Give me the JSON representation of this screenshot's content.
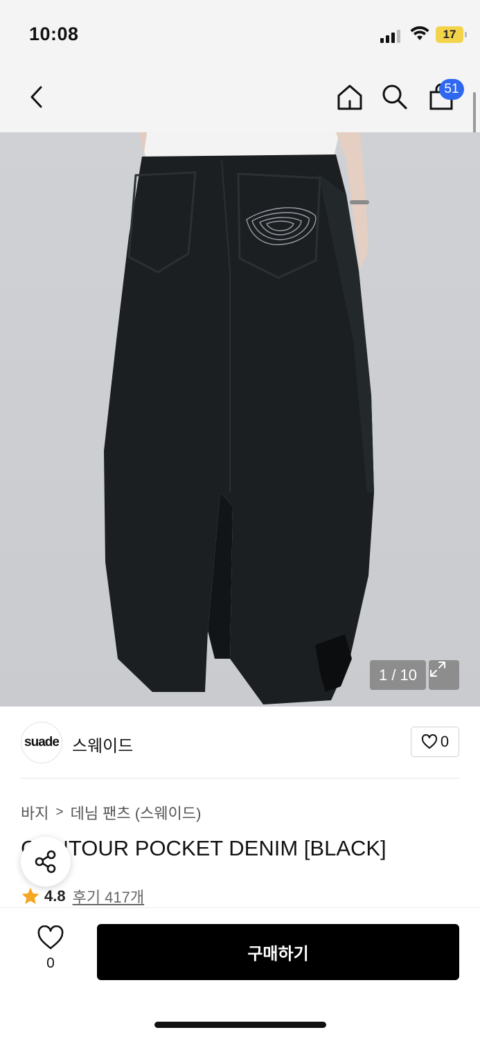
{
  "status_bar": {
    "time": "10:08",
    "battery": "17"
  },
  "nav": {
    "back_icon": "chevron-left-icon",
    "home_icon": "home-icon",
    "search_icon": "search-icon",
    "cart_icon": "shopping-bag-icon",
    "cart_count": "51"
  },
  "gallery": {
    "counter": "1 / 10",
    "expand_icon": "expand-icon"
  },
  "brand": {
    "logo_text": "suade",
    "name": "스웨이드",
    "like_count": "0"
  },
  "breadcrumb": {
    "category": "바지",
    "separator": ">",
    "subcategory": "데님 팬츠 (스웨이드)"
  },
  "product": {
    "title": "CONTOUR POCKET DENIM [BLACK]",
    "rating": "4.8",
    "reviews": "후기 417개"
  },
  "bottom": {
    "wish_count": "0",
    "buy_label": "구매하기"
  },
  "colors": {
    "accent_blue": "#2f68f0",
    "star": "#f5a623",
    "buy_bg": "#000000"
  }
}
